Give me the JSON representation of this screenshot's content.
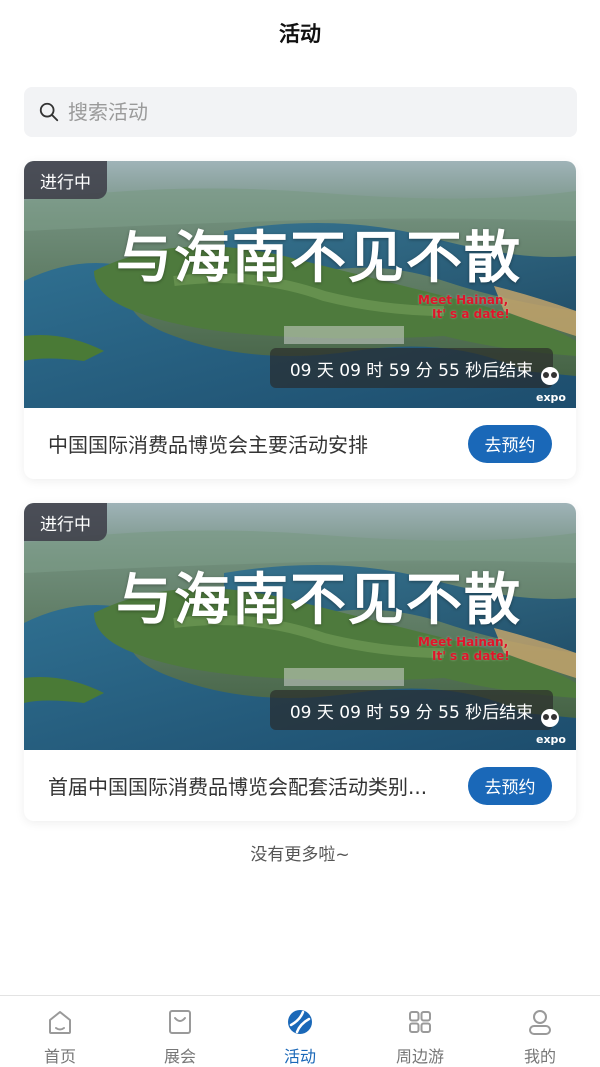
{
  "header": {
    "title": "活动"
  },
  "search": {
    "placeholder": "搜索活动",
    "value": ""
  },
  "events": [
    {
      "status": "进行中",
      "countdown": "09 天 09 时 59 分 55 秒后结束",
      "banner_text": {
        "main": "与海南不见不散",
        "slogan_line1": "Meet Hainan,",
        "slogan_line2": "It' s a date!",
        "logo_text": "expo"
      },
      "title": "中国国际消费品博览会主要活动安排",
      "button_label": "去预约"
    },
    {
      "status": "进行中",
      "countdown": "09 天 09 时 59 分 55 秒后结束",
      "banner_text": {
        "main": "与海南不见不散",
        "slogan_line1": "Meet Hainan,",
        "slogan_line2": "It' s a date!",
        "logo_text": "expo"
      },
      "title": "首届中国国际消费品博览会配套活动类别...",
      "button_label": "去预约"
    }
  ],
  "list_end_text": "没有更多啦~",
  "tabbar": {
    "items": [
      {
        "label": "首页",
        "icon": "home-icon",
        "active": false
      },
      {
        "label": "展会",
        "icon": "bag-icon",
        "active": false
      },
      {
        "label": "活动",
        "icon": "activity-icon",
        "active": true
      },
      {
        "label": "周边游",
        "icon": "grid-icon",
        "active": false
      },
      {
        "label": "我的",
        "icon": "user-icon",
        "active": false
      }
    ]
  },
  "colors": {
    "accent": "#1a68b8",
    "status_tag_bg": "#3c3c46",
    "slogan_red": "#e0142a"
  }
}
